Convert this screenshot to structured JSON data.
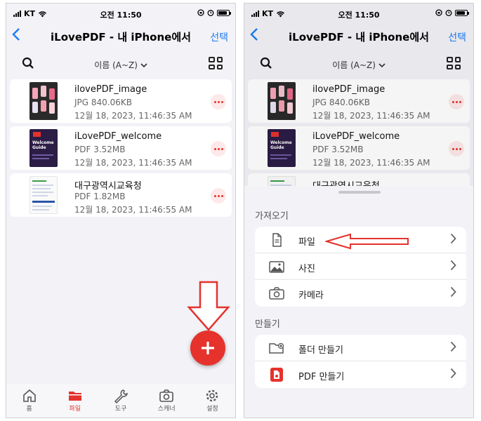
{
  "statusbar": {
    "carrier": "KT",
    "time": "오전 11:50"
  },
  "navbar": {
    "back_icon": "chevron-left-icon",
    "title": "iLovePDF - 내 iPhone에서",
    "select_label": "선택"
  },
  "toolbar": {
    "sort_label": "이름 (A~Z)"
  },
  "files": [
    {
      "name": "ilovePDF_image",
      "meta": "JPG 840.06KB",
      "date": "12월 18, 2023, 11:46:35 AM"
    },
    {
      "name": "iLovePDF_welcome",
      "meta": "PDF 3.52MB",
      "date": "12월 18, 2023, 11:46:35 AM"
    },
    {
      "name": "대구광역시교육청",
      "meta": "PDF 1.82MB",
      "date": "12월 18, 2023, 11:46:55 AM"
    }
  ],
  "thumbs": {
    "welcome_text": "Welcome Guide",
    "pdf_badge": "I♥PDF"
  },
  "tabs": [
    {
      "label": "홈",
      "icon": "home-icon"
    },
    {
      "label": "파일",
      "icon": "folder-icon"
    },
    {
      "label": "도구",
      "icon": "wrench-icon"
    },
    {
      "label": "스캐너",
      "icon": "camera-icon"
    },
    {
      "label": "설정",
      "icon": "gear-icon"
    }
  ],
  "sheet": {
    "import_title": "가져오기",
    "import_items": [
      {
        "label": "파일",
        "icon": "document-icon"
      },
      {
        "label": "사진",
        "icon": "photo-icon"
      },
      {
        "label": "카메라",
        "icon": "camera-icon"
      }
    ],
    "create_title": "만들기",
    "create_items": [
      {
        "label": "폴더 만들기",
        "icon": "folder-add-icon"
      },
      {
        "label": "PDF 만들기",
        "icon": "pdf-create-icon"
      }
    ]
  },
  "colors": {
    "accent": "#e5322d",
    "link": "#1e7cf2",
    "background": "#f2f2f7"
  }
}
